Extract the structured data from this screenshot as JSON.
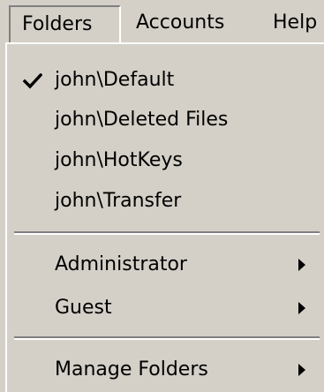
{
  "menubar": {
    "items": [
      {
        "label": "Folders"
      },
      {
        "label": "Accounts"
      },
      {
        "label": "Help"
      }
    ]
  },
  "folders_menu": {
    "items": [
      {
        "label": "john\\Default",
        "checked": true
      },
      {
        "label": "john\\Deleted Files"
      },
      {
        "label": "john\\HotKeys"
      },
      {
        "label": "john\\Transfer"
      },
      {
        "label": "Administrator",
        "submenu": true
      },
      {
        "label": "Guest",
        "submenu": true
      },
      {
        "label": "Manage Folders",
        "submenu": true
      }
    ]
  },
  "icons": {
    "check": "check-icon",
    "submenu_arrow": "submenu-arrow-icon"
  }
}
